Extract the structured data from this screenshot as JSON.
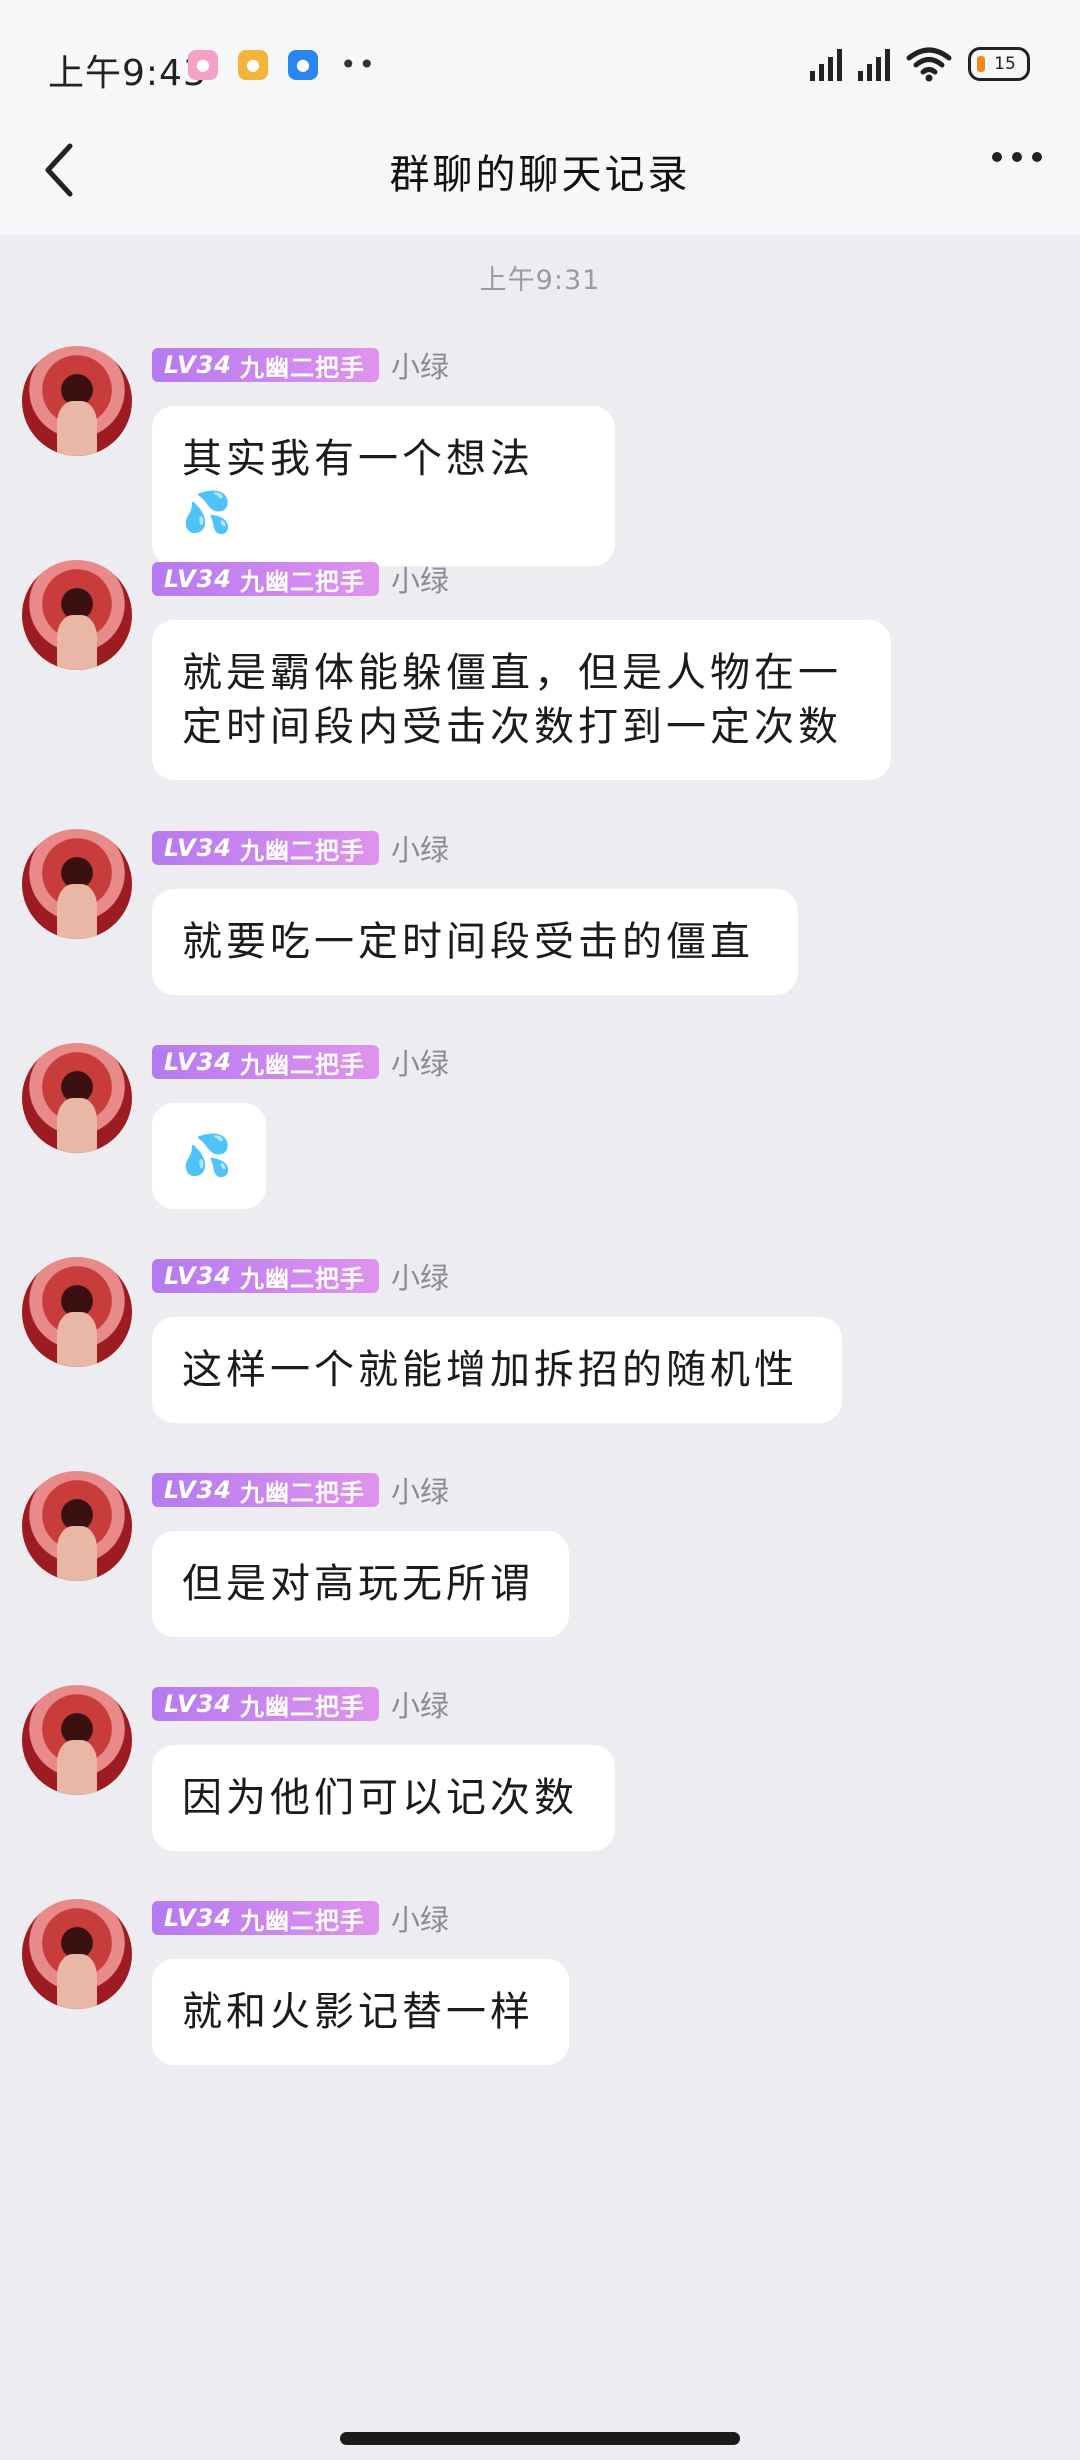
{
  "status_bar": {
    "time": "上午9:43",
    "more_indicator": "••",
    "battery": "15"
  },
  "nav": {
    "title": "群聊的聊天记录"
  },
  "chat": {
    "timestamp": "上午9:31",
    "messages": [
      {
        "badge_level": "LV34",
        "badge_title": "九幽二把手",
        "sender": "小绿",
        "text": "其实我有一个想法💦"
      },
      {
        "badge_level": "LV34",
        "badge_title": "九幽二把手",
        "sender": "小绿",
        "text": "就是霸体能躲僵直，但是人物在一定时间段内受击次数打到一定次数"
      },
      {
        "badge_level": "LV34",
        "badge_title": "九幽二把手",
        "sender": "小绿",
        "text": "就要吃一定时间段受击的僵直"
      },
      {
        "badge_level": "LV34",
        "badge_title": "九幽二把手",
        "sender": "小绿",
        "text": "💦"
      },
      {
        "badge_level": "LV34",
        "badge_title": "九幽二把手",
        "sender": "小绿",
        "text": "这样一个就能增加拆招的随机性"
      },
      {
        "badge_level": "LV34",
        "badge_title": "九幽二把手",
        "sender": "小绿",
        "text": "但是对高玩无所谓"
      },
      {
        "badge_level": "LV34",
        "badge_title": "九幽二把手",
        "sender": "小绿",
        "text": "因为他们可以记次数"
      },
      {
        "badge_level": "LV34",
        "badge_title": "九幽二把手",
        "sender": "小绿",
        "text": "就和火影记替一样"
      }
    ]
  }
}
